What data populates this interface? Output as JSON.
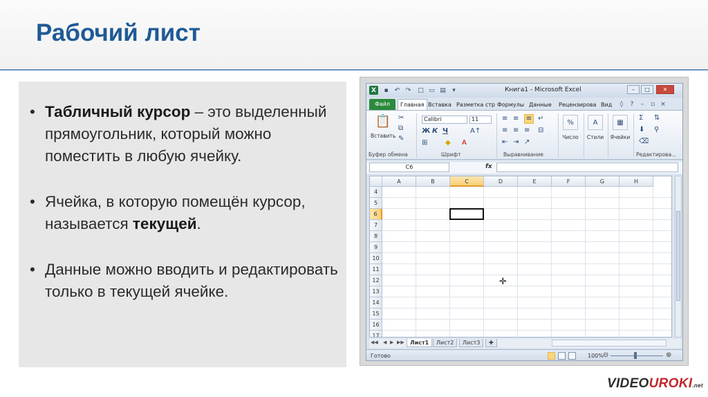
{
  "slide": {
    "title": "Рабочий лист",
    "bullets": [
      {
        "bold": "Табличный курсор",
        "text": " – это выделенный прямоугольник, который можно поместить в любую ячейку."
      },
      {
        "pre": "Ячейка, в которую помещён курсор, называется ",
        "bold": "текущей",
        "post": "."
      },
      {
        "text": "Данные можно вводить и редактировать только в текущей ячейке."
      }
    ]
  },
  "excel": {
    "window_title": "Книга1 - Microsoft Excel",
    "tabs": {
      "file": "Файл",
      "items": [
        "Главная",
        "Вставка",
        "Разметка стр",
        "Формулы",
        "Данные",
        "Рецензирова",
        "Вид"
      ]
    },
    "ribbon": {
      "paste_label": "Вставить",
      "font_name": "Calibri",
      "font_size": "11",
      "bold": "Ж",
      "italic": "К",
      "underline": "Ч",
      "number_label": "Число",
      "styles_label": "Стили",
      "cells_label": "Ячейки",
      "groups": [
        "Буфер обмена",
        "Шрифт",
        "Выравнивание",
        "Редактирова..."
      ]
    },
    "name_box": "C6",
    "fx": "fx",
    "columns": [
      "A",
      "B",
      "C",
      "D",
      "E",
      "F",
      "G",
      "H"
    ],
    "rows": [
      "4",
      "5",
      "6",
      "7",
      "8",
      "9",
      "10",
      "11",
      "12",
      "13",
      "14",
      "15",
      "16",
      "17"
    ],
    "selected_cell": {
      "col": "C",
      "row": "6"
    },
    "sheets": [
      "Лист1",
      "Лист2",
      "Лист3"
    ],
    "status": "Готово",
    "zoom": "100%"
  },
  "logo": {
    "part1": "VIDEO",
    "part2": "UROKI",
    "part3": ".net"
  },
  "colors": {
    "title": "#1f5a96",
    "accent_line": "#6d95c6",
    "file_tab": "#2c8a3c"
  }
}
